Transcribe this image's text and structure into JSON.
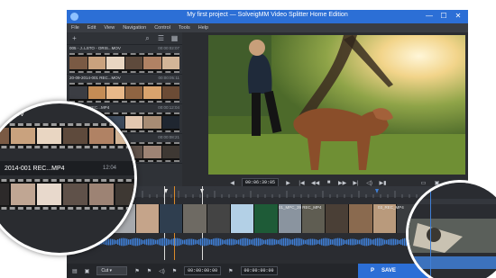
{
  "window": {
    "title": "My first project — SolveigMM Video Splitter Home Edition",
    "controls": {
      "minimize": "—",
      "maximize": "☐",
      "close": "✕"
    }
  },
  "menu": [
    "File",
    "Edit",
    "View",
    "Navigation",
    "Control",
    "Tools",
    "Help"
  ],
  "media_list": {
    "clips": [
      {
        "name": "005 - J..LSTO - ORIS...MOV",
        "duration": "00:00:02:07",
        "colors": [
          "#7a5a44",
          "#c9a27e",
          "#e9d6c2",
          "#5e4a3c",
          "#b08264",
          "#d3b597"
        ]
      },
      {
        "name": "20-09-2014-001 REC...MOV",
        "duration": "00:00:05:11",
        "colors": [
          "#3b3d43",
          "#c48c55",
          "#e8b889",
          "#8f6442",
          "#d9a36d",
          "#6b4b35"
        ]
      },
      {
        "name": "03-10-001 REC...MP4",
        "duration": "00:00:12:04",
        "colors": [
          "#e5e0d8",
          "#70685f",
          "#3d4a5c",
          "#e2c7b0",
          "#a78c74",
          "#1f2630"
        ]
      },
      {
        "name": "2014-001 REC...MP4",
        "duration": "00:00:08:21",
        "colors": [
          "#2d2a2a",
          "#c0a693",
          "#e8d9cc",
          "#5f5149",
          "#9d8374",
          "#3e3833"
        ]
      }
    ]
  },
  "magnifier_left": {
    "top_label": "...MOV",
    "clip_name": "2014-001 REC...MP4",
    "clip_duration": "12:04"
  },
  "player": {
    "current_time": "00:06:39:05",
    "controls": [
      "◀",
      "▶",
      "|◀",
      "◀◀",
      "■",
      "▶▶",
      "▶|",
      "◁)",
      "▶▮"
    ]
  },
  "timeline": {
    "track_label": "01_MPC_39 REC_MP4",
    "track_label_2": "03_REC_MP4",
    "frame_colors": [
      "#3d4047",
      "#a7a9ad",
      "#c5a48a",
      "#2f3e4f",
      "#6e6a63",
      "#444",
      "#b3d0e6",
      "#1e5b37",
      "#8a949f",
      "#5f5d52",
      "#4a3f36",
      "#8a6a4f",
      "#b99a7c",
      "#3a3c3f",
      "#5e7fa8",
      "#2d2f33"
    ]
  },
  "bottombar": {
    "mode": "Cut",
    "start_time": "00:00:00:00",
    "end_time": "00:00:00:00",
    "save_label": "SAVE"
  },
  "colors": {
    "accent": "#2c6fd6",
    "waveform": "#3f7fd6",
    "marker": "#d98a2a"
  }
}
